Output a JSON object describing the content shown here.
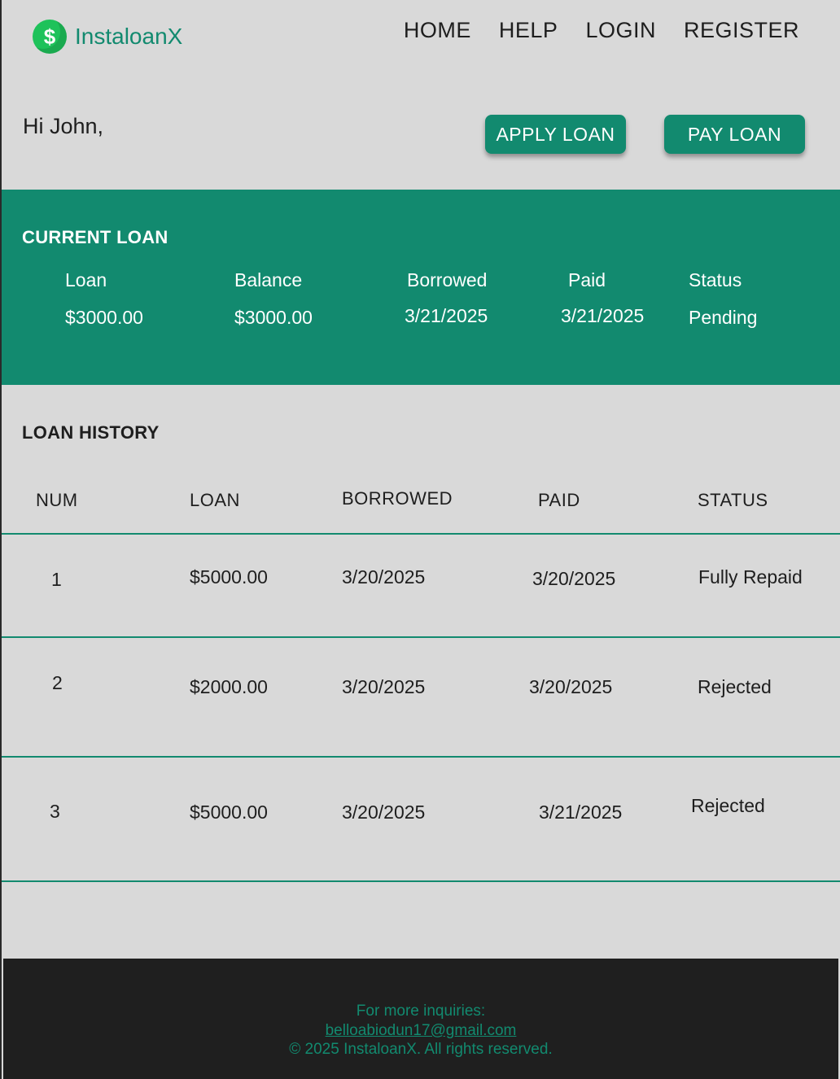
{
  "brand": {
    "name": "InstaloanX",
    "icon": "dollar-icon",
    "symbol": "$"
  },
  "nav": {
    "home": "HOME",
    "help": "HELP",
    "login": "LOGIN",
    "register": "REGISTER"
  },
  "greeting": "Hi John,",
  "actions": {
    "apply": "APPLY LOAN",
    "pay": "PAY LOAN"
  },
  "current_loan": {
    "title": "CURRENT LOAN",
    "labels": {
      "loan": "Loan",
      "balance": "Balance",
      "borrowed": "Borrowed",
      "paid": "Paid",
      "status": "Status"
    },
    "values": {
      "loan": "$3000.00",
      "balance": "$3000.00",
      "borrowed": "3/21/2025",
      "paid": "3/21/2025",
      "status": "Pending"
    }
  },
  "history": {
    "title": "LOAN HISTORY",
    "headers": {
      "num": "NUM",
      "loan": "LOAN",
      "borrowed": "BORROWED",
      "paid": "PAID",
      "status": "STATUS"
    },
    "rows": [
      {
        "num": "1",
        "loan": "$5000.00",
        "borrowed": "3/20/2025",
        "paid": "3/20/2025",
        "status": "Fully Repaid"
      },
      {
        "num": "2",
        "loan": "$2000.00",
        "borrowed": "3/20/2025",
        "paid": "3/20/2025",
        "status": "Rejected"
      },
      {
        "num": "3",
        "loan": "$5000.00",
        "borrowed": "3/20/2025",
        "paid": "3/21/2025",
        "status": "Rejected"
      }
    ]
  },
  "footer": {
    "inquiries": "For more inquiries:",
    "email": "belloabiodun17@gmail.com",
    "copyright": "© 2025 InstaloanX. All rights reserved."
  },
  "colors": {
    "accent": "#128a6f",
    "logo_green": "#1ec25a",
    "background": "#d9d9d9",
    "footer_bg": "#1f1f1f"
  }
}
